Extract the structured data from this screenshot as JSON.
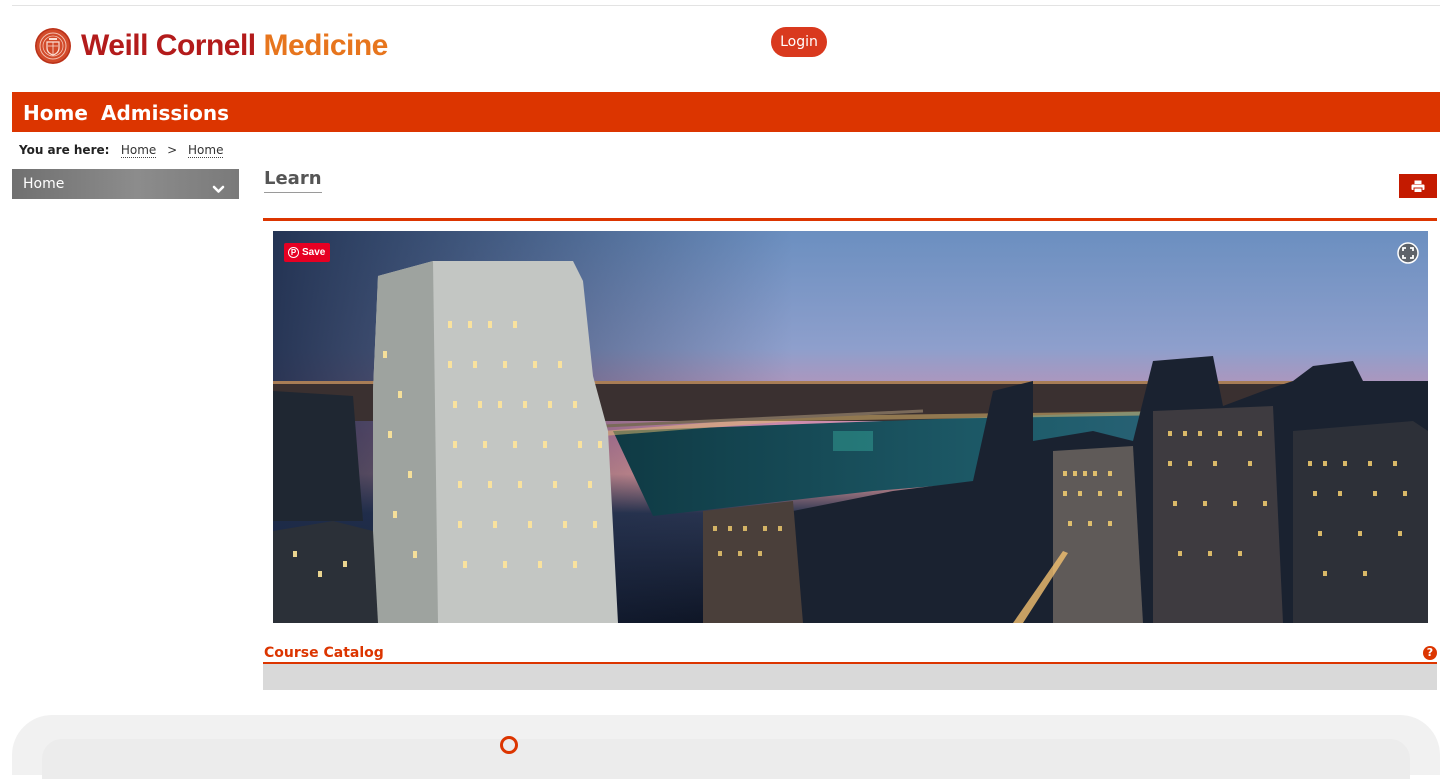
{
  "header": {
    "logo_word1": "Weill Cornell",
    "logo_word2": "Medicine",
    "login_label": "Login"
  },
  "nav": {
    "items": [
      {
        "label": "Home"
      },
      {
        "label": "Admissions"
      }
    ]
  },
  "breadcrumb": {
    "label": "You are here:",
    "items": [
      "Home",
      "Home"
    ],
    "separator": ">"
  },
  "sidebar": {
    "select_value": "Home"
  },
  "main": {
    "title": "Learn",
    "banner": {
      "pin_label": "Save"
    },
    "section": {
      "title": "Course Catalog",
      "help_glyph": "?"
    }
  },
  "colors": {
    "brand_red": "#dc3500",
    "logo_dark_red": "#b31b1b",
    "logo_orange": "#e7751d",
    "pinterest_red": "#e60023"
  },
  "icons": [
    "seal-logo-icon",
    "chevron-down-icon",
    "print-icon",
    "pinterest-icon",
    "fullscreen-icon",
    "help-icon"
  ]
}
